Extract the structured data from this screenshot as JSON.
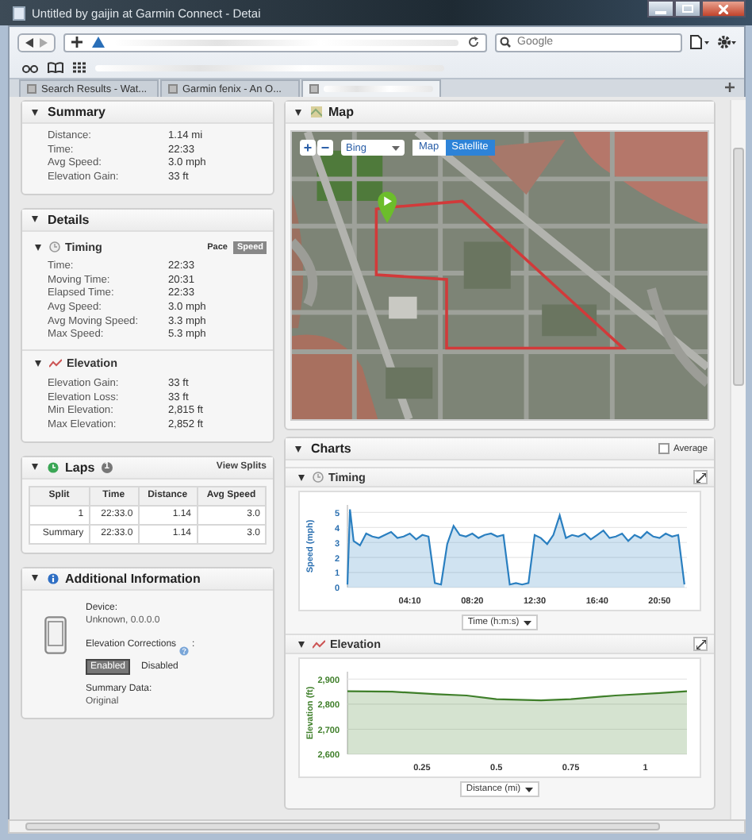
{
  "window": {
    "title": "Untitled by gaijin at Garmin Connect - Detai"
  },
  "search": {
    "placeholder": "Google"
  },
  "tabs": [
    {
      "label": "Search Results - Wat...",
      "selected": false
    },
    {
      "label": "Garmin fenix - An O...",
      "selected": false
    },
    {
      "selected": true
    }
  ],
  "summary": {
    "title": "Summary",
    "expanded": true,
    "rows": [
      {
        "label": "Distance:",
        "value": "1.14 mi"
      },
      {
        "label": "Time:",
        "value": "22:33"
      },
      {
        "label": "Avg Speed:",
        "value": "3.0 mph"
      },
      {
        "label": "Elevation Gain:",
        "value": "33 ft"
      }
    ]
  },
  "details": {
    "title": "Details",
    "expanded": true,
    "sections": [
      {
        "title": "Timing",
        "kind": "timing",
        "expanded": true,
        "toggle": [
          {
            "label": "Pace",
            "selected": false
          },
          {
            "label": "Speed",
            "selected": true
          }
        ],
        "rows": [
          {
            "label": "Time:",
            "value": "22:33"
          },
          {
            "label": "Moving Time:",
            "value": "20:31"
          },
          {
            "label": "Elapsed Time:",
            "value": "22:33"
          },
          {
            "label": "Avg Speed:",
            "value": "3.0 mph"
          },
          {
            "label": "Avg Moving Speed:",
            "value": "3.3 mph"
          },
          {
            "label": "Max Speed:",
            "value": "5.3 mph"
          }
        ]
      },
      {
        "title": "Elevation",
        "kind": "elevation",
        "expanded": true,
        "rows": [
          {
            "label": "Elevation Gain:",
            "value": "33 ft"
          },
          {
            "label": "Elevation Loss:",
            "value": "33 ft"
          },
          {
            "label": "Min Elevation:",
            "value": "2,815 ft"
          },
          {
            "label": "Max Elevation:",
            "value": "2,852 ft"
          }
        ]
      }
    ]
  },
  "laps": {
    "title": "Laps",
    "expanded": true,
    "count": "1",
    "link": "View Splits",
    "columns": [
      "Split",
      "Time",
      "Distance",
      "Avg Speed"
    ],
    "rows": [
      [
        "1",
        "22:33.0",
        "1.14",
        "3.0"
      ],
      [
        "Summary",
        "22:33.0",
        "1.14",
        "3.0"
      ]
    ]
  },
  "additional_info": {
    "title": "Additional Information",
    "expanded": true,
    "device_label": "Device:",
    "device": "Unknown, 0.0.0.0",
    "elevation_label": "Elevation Corrections",
    "elevation_colon": ":",
    "options": [
      {
        "label": "Enabled",
        "selected": true
      },
      {
        "label": "Disabled",
        "selected": false
      }
    ],
    "summary_label": "Summary Data:",
    "summary_value": "Original"
  },
  "map": {
    "title": "Map",
    "expanded": true,
    "zoom_in": "+",
    "zoom_out": "−",
    "provider": "Bing",
    "types": [
      {
        "label": "Map",
        "selected": false
      },
      {
        "label": "Satellite",
        "selected": true
      }
    ]
  },
  "charts": {
    "title": "Charts",
    "expanded": true,
    "average": {
      "label": "Average",
      "checked": false
    },
    "panels": [
      {
        "title": "Timing",
        "kind": "timing",
        "expanded": true,
        "chart_data": {
          "type": "area",
          "xlabel": "Time (h:m:s)",
          "ylabel": "Speed (mph)",
          "x": [
            0,
            10,
            25,
            50,
            75,
            100,
            125,
            150,
            175,
            200,
            225,
            250,
            275,
            300,
            325,
            350,
            375,
            400,
            425,
            450,
            475,
            500,
            525,
            550,
            575,
            600,
            625,
            650,
            675,
            700,
            725,
            750,
            775,
            800,
            825,
            850,
            875,
            900,
            925,
            950,
            975,
            1000,
            1025,
            1050,
            1075,
            1100,
            1125,
            1150,
            1175,
            1200,
            1225,
            1250,
            1275,
            1300,
            1325,
            1350
          ],
          "grid": true,
          "series": [
            {
              "color": "#2a7fc0",
              "values": [
                0.2,
                5.2,
                3.1,
                2.8,
                3.6,
                3.4,
                3.3,
                3.5,
                3.7,
                3.3,
                3.4,
                3.6,
                3.2,
                3.5,
                3.4,
                0.3,
                0.2,
                2.9,
                4.1,
                3.5,
                3.4,
                3.6,
                3.3,
                3.5,
                3.6,
                3.4,
                3.5,
                0.2,
                0.3,
                0.2,
                0.3,
                3.5,
                3.3,
                2.9,
                3.5,
                4.8,
                3.3,
                3.5,
                3.4,
                3.6,
                3.2,
                3.5,
                3.8,
                3.3,
                3.4,
                3.6,
                3.1,
                3.5,
                3.3,
                3.7,
                3.4,
                3.3,
                3.6,
                3.4,
                3.5,
                0.2
              ]
            }
          ],
          "xlim": [
            0,
            1360
          ],
          "ylim": [
            0,
            5.5
          ],
          "yticks": [
            0,
            1,
            2,
            3,
            4,
            5
          ],
          "xticks": [
            {
              "value": 250,
              "label": "04:10"
            },
            {
              "value": 500,
              "label": "08:20"
            },
            {
              "value": 750,
              "label": "12:30"
            },
            {
              "value": 1000,
              "label": "16:40"
            },
            {
              "value": 1250,
              "label": "20:50"
            }
          ]
        }
      },
      {
        "title": "Elevation",
        "kind": "elevation",
        "expanded": true,
        "chart_data": {
          "type": "area",
          "xlabel": "Distance (mi)",
          "ylabel": "Elevation (ft)",
          "x": [
            0,
            0.15,
            0.3,
            0.4,
            0.5,
            0.65,
            0.75,
            0.9,
            1.05,
            1.14
          ],
          "grid": true,
          "series": [
            {
              "color": "#3f7f2a",
              "values": [
                2852,
                2850,
                2840,
                2835,
                2820,
                2815,
                2820,
                2835,
                2845,
                2852
              ]
            }
          ],
          "xlim": [
            0,
            1.14
          ],
          "ylim": [
            2600,
            2930
          ],
          "yticks": [
            {
              "value": 2600,
              "label": "2,600"
            },
            {
              "value": 2700,
              "label": "2,700"
            },
            {
              "value": 2800,
              "label": "2,800"
            },
            {
              "value": 2900,
              "label": "2,900"
            }
          ],
          "xticks": [
            {
              "value": 0.25,
              "label": "0.25"
            },
            {
              "value": 0.5,
              "label": "0.5"
            },
            {
              "value": 0.75,
              "label": "0.75"
            },
            {
              "value": 1,
              "label": "1"
            }
          ]
        }
      }
    ]
  }
}
